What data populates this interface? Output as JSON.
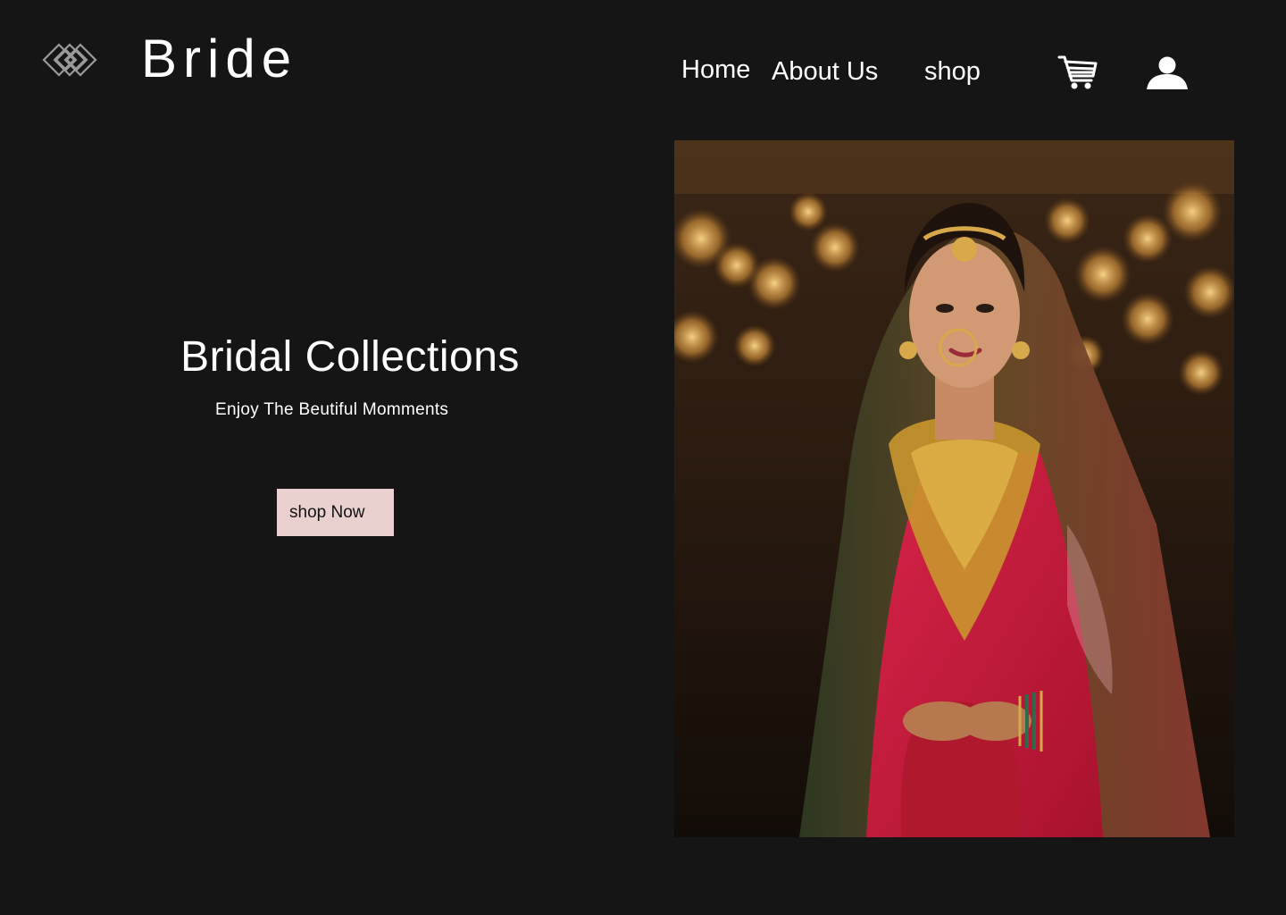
{
  "brand": {
    "name": "Bride",
    "logo_icon": "interlocking-diamonds-icon"
  },
  "nav": {
    "items": [
      {
        "label": "Home"
      },
      {
        "label": "About Us"
      },
      {
        "label": "shop"
      }
    ],
    "cart_icon": "shopping-cart-icon",
    "user_icon": "user-profile-icon"
  },
  "hero": {
    "title": "Bridal Collections",
    "subtitle": "Enjoy The Beutiful Momments",
    "cta_label": "shop Now",
    "image_subject": "bride-portrait"
  },
  "colors": {
    "background": "#161516",
    "text": "#ffffff",
    "cta_background": "#ebd0d0",
    "cta_text": "#111111"
  }
}
